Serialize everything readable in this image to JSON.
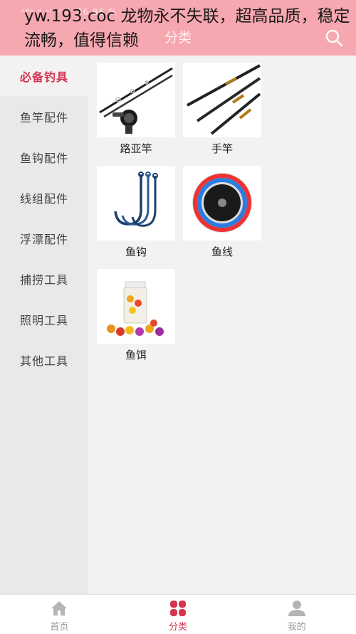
{
  "status_bar": {
    "text": "ᵒ⁶ᵒ ᵸ ⁿˡ ⁿˡ ☾ 86 86 %"
  },
  "header": {
    "title": "分类"
  },
  "overlay": {
    "text": "yw.193.coc 龙物永不失联，超高品质，稳定流畅，值得信赖"
  },
  "sidebar": {
    "items": [
      {
        "label": "必备钓具",
        "active": true
      },
      {
        "label": "鱼竿配件"
      },
      {
        "label": "鱼钩配件"
      },
      {
        "label": "线组配件"
      },
      {
        "label": "浮漂配件"
      },
      {
        "label": "捕捞工具"
      },
      {
        "label": "照明工具"
      },
      {
        "label": "其他工具"
      }
    ]
  },
  "products": [
    {
      "label": "路亚竿",
      "icon": "spinning-rod-image"
    },
    {
      "label": "手竿",
      "icon": "hand-rod-image"
    },
    {
      "label": "鱼钩",
      "icon": "fish-hook-image"
    },
    {
      "label": "鱼线",
      "icon": "fishing-line-spool-image"
    },
    {
      "label": "鱼饵",
      "icon": "bait-jar-image"
    }
  ],
  "tabbar": {
    "items": [
      {
        "label": "首页",
        "icon": "home-icon"
      },
      {
        "label": "分类",
        "icon": "category-icon",
        "active": true
      },
      {
        "label": "我的",
        "icon": "user-icon"
      }
    ]
  },
  "colors": {
    "accent": "#d6334f",
    "header": "#f7a7b0"
  }
}
